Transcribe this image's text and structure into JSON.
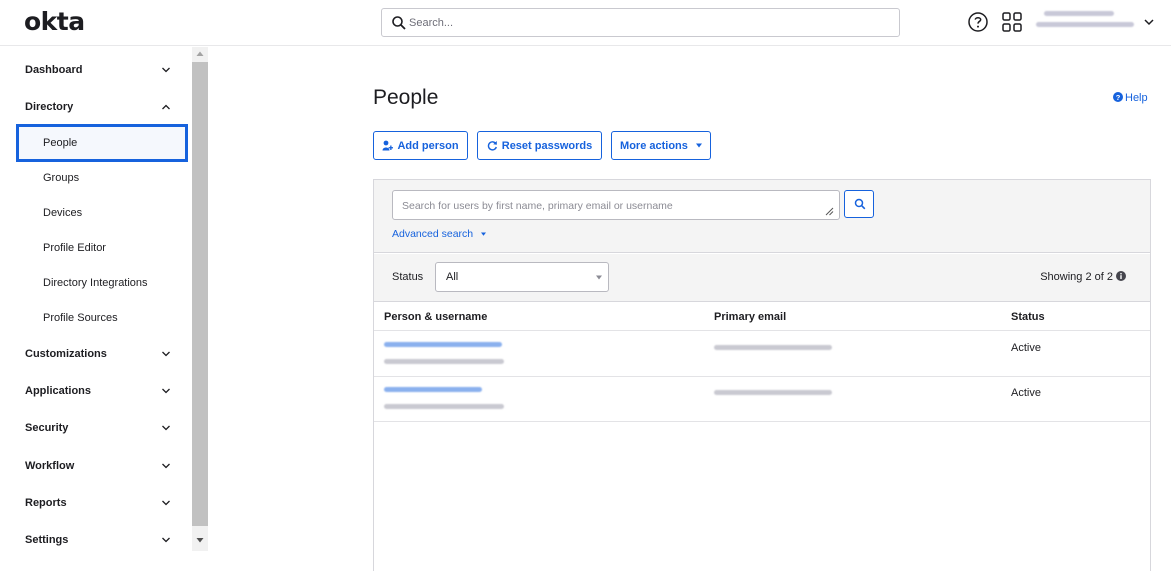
{
  "header": {
    "logo": "okta",
    "search_placeholder": "Search..."
  },
  "sidebar": {
    "sections": [
      {
        "label": "Dashboard",
        "expanded": false
      },
      {
        "label": "Directory",
        "expanded": true
      },
      {
        "label": "Customizations",
        "expanded": false
      },
      {
        "label": "Applications",
        "expanded": false
      },
      {
        "label": "Security",
        "expanded": false
      },
      {
        "label": "Workflow",
        "expanded": false
      },
      {
        "label": "Reports",
        "expanded": false
      },
      {
        "label": "Settings",
        "expanded": false
      }
    ],
    "directory_items": [
      {
        "label": "People",
        "active": true
      },
      {
        "label": "Groups",
        "active": false
      },
      {
        "label": "Devices",
        "active": false
      },
      {
        "label": "Profile Editor",
        "active": false
      },
      {
        "label": "Directory Integrations",
        "active": false
      },
      {
        "label": "Profile Sources",
        "active": false
      }
    ]
  },
  "main": {
    "title": "People",
    "help": "Help",
    "buttons": {
      "add_person": "Add person",
      "reset_passwords": "Reset passwords",
      "more_actions": "More actions"
    },
    "search": {
      "placeholder": "Search for users by first name, primary email or username",
      "advanced": "Advanced search"
    },
    "filter": {
      "status_label": "Status",
      "status_value": "All",
      "showing": "Showing 2 of 2"
    },
    "table": {
      "headers": [
        "Person & username",
        "Primary email",
        "Status"
      ],
      "rows": [
        {
          "status": "Active"
        },
        {
          "status": "Active"
        }
      ]
    }
  },
  "colors": {
    "accent": "#1662dd",
    "text": "#1d1d21",
    "panel_bg": "#f4f4f4"
  },
  "icons": [
    "search-icon",
    "help-circle-icon",
    "apps-grid-icon",
    "chevron-down-icon",
    "chevron-up-icon",
    "add-person-icon",
    "refresh-icon",
    "info-icon"
  ]
}
